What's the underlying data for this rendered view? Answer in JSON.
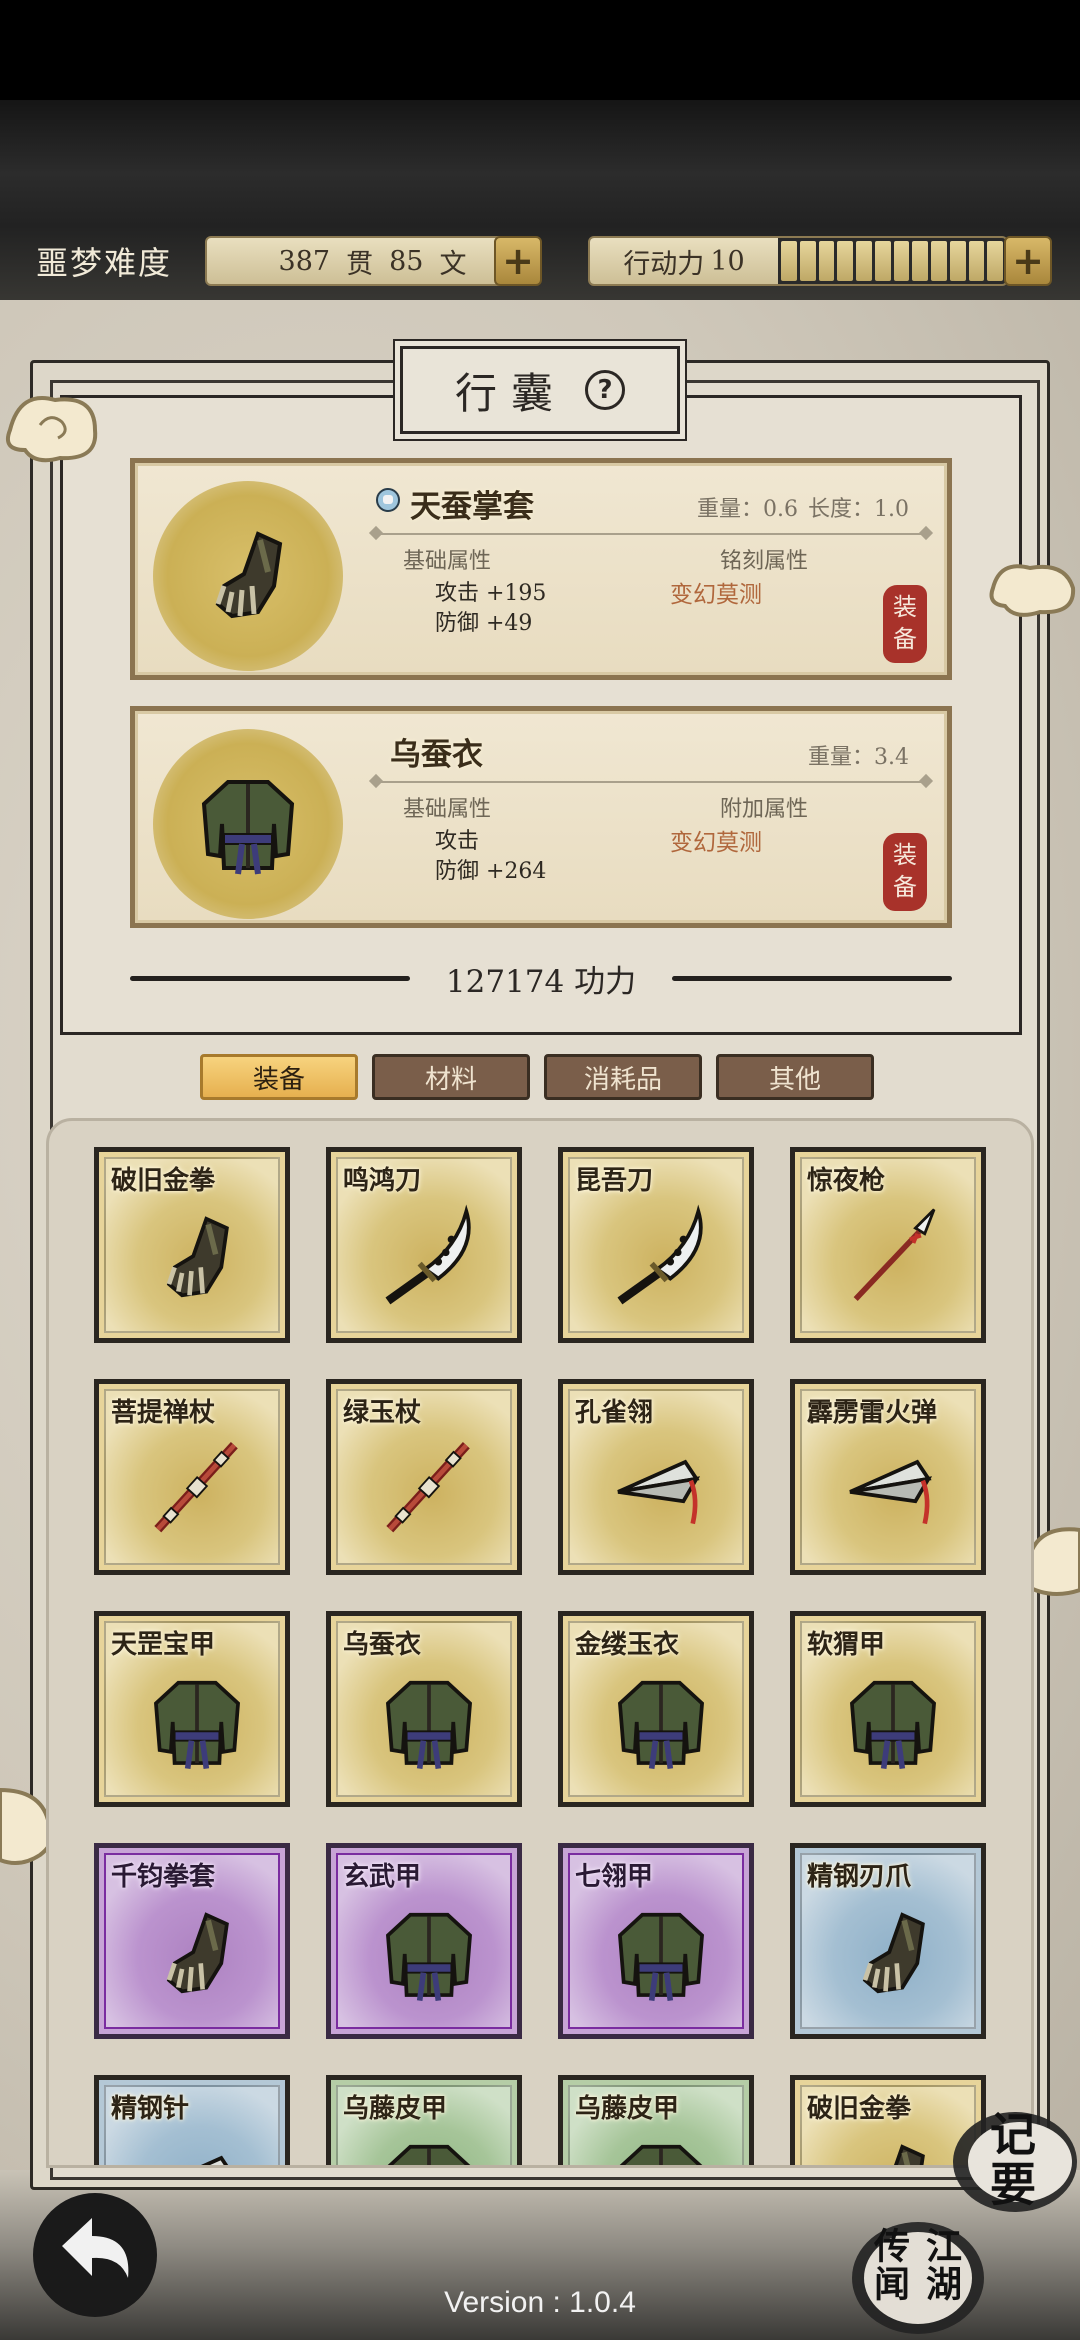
{
  "header": {
    "difficulty": "噩梦难度",
    "money": {
      "guan_value": "387",
      "guan_unit": "贯",
      "wen_value": "85",
      "wen_unit": "文"
    },
    "action_points": {
      "label": "行动力",
      "value": "10",
      "segments": 12
    }
  },
  "panel": {
    "title": "行囊",
    "help_icon": "question-mark-icon",
    "equipped": [
      {
        "name": "天蚕掌套",
        "weight_label": "重量：",
        "weight": "0.6",
        "length_label": "长度：",
        "length": "1.0",
        "basic_label": "基础属性",
        "extra_label": "铭刻属性",
        "attack": "攻击 +195",
        "defense": "防御 +49",
        "extra_value": "变幻莫测",
        "stamp": "装备",
        "icon": "gauntlet-icon"
      },
      {
        "name": "乌蚕衣",
        "weight_label": "重量：",
        "weight": "3.4",
        "basic_label": "基础属性",
        "extra_label": "附加属性",
        "attack": "攻击",
        "defense": "防御 +264",
        "extra_value": "变幻莫测",
        "stamp": "装备",
        "icon": "armor-icon"
      }
    ],
    "power": "127174 功力"
  },
  "tabs": [
    {
      "label": "装备",
      "active": true
    },
    {
      "label": "材料",
      "active": false
    },
    {
      "label": "消耗品",
      "active": false
    },
    {
      "label": "其他",
      "active": false
    }
  ],
  "inventory": [
    {
      "name": "破旧金拳",
      "rarity": "gold",
      "icon": "gauntlet-icon"
    },
    {
      "name": "鸣鸿刀",
      "rarity": "gold",
      "icon": "saber-icon"
    },
    {
      "name": "昆吾刀",
      "rarity": "gold",
      "icon": "saber-icon"
    },
    {
      "name": "惊夜枪",
      "rarity": "gold",
      "icon": "spear-icon"
    },
    {
      "name": "菩提禅杖",
      "rarity": "gold",
      "icon": "staff-icon"
    },
    {
      "name": "绿玉杖",
      "rarity": "gold",
      "icon": "staff-icon"
    },
    {
      "name": "孔雀翎",
      "rarity": "gold",
      "icon": "dart-icon"
    },
    {
      "name": "霹雳雷火弹",
      "rarity": "gold",
      "icon": "dart-icon"
    },
    {
      "name": "天罡宝甲",
      "rarity": "gold",
      "icon": "armor-icon"
    },
    {
      "name": "乌蚕衣",
      "rarity": "gold",
      "icon": "armor-icon"
    },
    {
      "name": "金缕玉衣",
      "rarity": "gold",
      "icon": "armor-icon"
    },
    {
      "name": "软猬甲",
      "rarity": "gold",
      "icon": "armor-icon"
    },
    {
      "name": "千钧拳套",
      "rarity": "purple",
      "icon": "gauntlet-icon"
    },
    {
      "name": "玄武甲",
      "rarity": "purple",
      "icon": "armor-icon"
    },
    {
      "name": "七翎甲",
      "rarity": "purple",
      "icon": "armor-icon"
    },
    {
      "name": "精钢刃爪",
      "rarity": "blue",
      "icon": "gauntlet-icon"
    },
    {
      "name": "精钢针",
      "rarity": "blue",
      "icon": "dart-icon"
    },
    {
      "name": "乌藤皮甲",
      "rarity": "green",
      "icon": "armor-icon"
    },
    {
      "name": "乌藤皮甲",
      "rarity": "green",
      "icon": "armor-icon"
    },
    {
      "name": "破旧金拳",
      "rarity": "gold",
      "icon": "gauntlet-icon"
    }
  ],
  "bottom": {
    "back_icon": "back-arrow-icon",
    "version": "Version : 1.0.4",
    "notes_button": "记要",
    "news_button": "江湖传闻"
  },
  "colors": {
    "gold": "#e7d49a",
    "purple": "#c7a4d6",
    "blue": "#b4c8d6",
    "green": "#b5cda6",
    "accent_red": "#a8322a",
    "mystery_text": "#b0673c"
  }
}
